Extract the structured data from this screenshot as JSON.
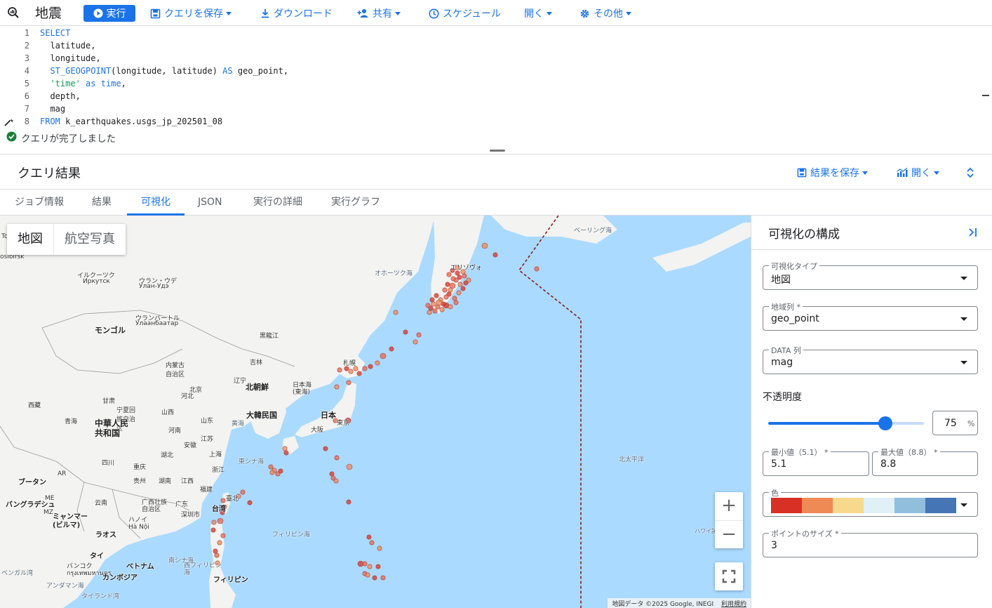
{
  "toolbar": {
    "title": "地震",
    "run": "実行",
    "save_query": "クエリを保存",
    "download": "ダウンロード",
    "share": "共有",
    "schedule": "スケジュール",
    "open": "開く",
    "more": "その他"
  },
  "editor": {
    "lines": [
      {
        "n": "1",
        "text": "SELECT"
      },
      {
        "n": "2",
        "text": "  latitude,"
      },
      {
        "n": "3",
        "text": "  longitude,"
      },
      {
        "n": "4",
        "text": "  ST_GEOGPOINT(longitude, latitude) AS geo_point,"
      },
      {
        "n": "5",
        "text": "  'time' as time,"
      },
      {
        "n": "6",
        "text": "  depth,"
      },
      {
        "n": "7",
        "text": "  mag"
      },
      {
        "n": "8",
        "text": "FROM k_earthquakes.usgs_jp_202501_08"
      }
    ]
  },
  "status": {
    "text": "クエリが完了しました"
  },
  "results": {
    "title": "クエリ結果",
    "save_results": "結果を保存",
    "open": "開く",
    "tabs": [
      "ジョブ情報",
      "結果",
      "可視化",
      "JSON",
      "実行の詳細",
      "実行グラフ"
    ],
    "active_tab": 2
  },
  "map": {
    "type_buttons": {
      "map": "地図",
      "satellite": "航空写真"
    },
    "zoom_in": "+",
    "zoom_out": "−",
    "attribution": "地図データ ©2025 Google, INEGI",
    "terms": "利用規約",
    "labels": {
      "bering": "ベーリング海",
      "okhotsk": "オホーツク海",
      "elizovo": "エリゾヴォ",
      "irkutsk_ja": "イルクーツク",
      "irkutsk_ru": "Иркутск",
      "ulanude_ja": "ウラン・ウデ",
      "ulanude_ru": "Улан-Удэ",
      "ulaanbaatar_ja": "ウランバートル",
      "ulaanbaatar_mn": "Улаанбаатар",
      "mongol": "モンゴル",
      "heilongjiang": "黒龍江",
      "jilin": "吉林",
      "neimenggu": "内蒙古自治区",
      "liaoning": "辽宁",
      "beijing": "北京",
      "hebei": "河北",
      "shanxi": "山西",
      "shandong": "山东",
      "ningxia": "宁夏回族自治区",
      "gansu": "甘肃",
      "qinghai": "青海",
      "north_korea": "北朝鮮",
      "south_korea": "大韓民国",
      "japan_sea": "日本海\n(東海)",
      "japan": "日本",
      "sapporo": "札幌",
      "tokyo": "東京",
      "osaka": "大阪",
      "yellow_sea": "黄海",
      "china": "中華人民\n共和国",
      "henan": "河南",
      "jiangsu": "江苏",
      "shanghai": "上海",
      "anhui": "安徽",
      "zhejiang": "浙江",
      "hubei": "湖北",
      "sichuan": "四川",
      "chongqing": "重庆",
      "hunan": "湖南",
      "jiangxi": "江西",
      "fujian": "福建",
      "guizhou": "贵州",
      "yunnan": "云南",
      "guangxi": "广西壮族\n自治区",
      "guangdong": "广东",
      "shenzhen": "深圳市",
      "taipei": "臺北",
      "taiwan": "台湾",
      "east_china_sea": "東シナ海",
      "philippine_sea": "フィリピン海",
      "south_china_sea": "南シナ海",
      "west_philippine_sea": "西フィリピン\n海",
      "philippines": "フィリピン",
      "bhutan": "ブータン",
      "bangladesh": "バングラデシュ",
      "myanmar": "ミャンマー\n(ビルマ)",
      "hanoi": "ハノイ\nHà Nội",
      "laos": "ラオス",
      "thailand": "タイ",
      "bangkok": "バンコク\nกรุงเทพมหานคร",
      "vietnam": "ベトナム",
      "cambodia": "カンボジア",
      "andaman": "アンダマン海",
      "thai_gulf": "タイランド湾",
      "bengal": "ベンガル湾",
      "pacific": "北太平洋",
      "hawaii": "ハワイ諸島",
      "xizang": "西藏",
      "ar": "AR",
      "me": "ME",
      "mz": "MZ",
      "to": "To",
      "novosibirsk": "osibirsk"
    }
  },
  "panel": {
    "title": "可視化の構成",
    "viz_type": {
      "label": "可視化タイプ",
      "value": "地図"
    },
    "geo_col": {
      "label": "地域列 *",
      "value": "geo_point"
    },
    "data_col": {
      "label": "DATA 列",
      "value": "mag"
    },
    "opacity": {
      "label": "不透明度",
      "value": "75",
      "unit": "%",
      "level": 0.75
    },
    "min": {
      "label": "最小値（5.1） *",
      "value": "5.1"
    },
    "max": {
      "label": "最大値（8.8） *",
      "value": "8.8"
    },
    "color": {
      "label": "色",
      "palette": [
        "#d93025",
        "#ef8a55",
        "#f6d98c",
        "#dff0f7",
        "#92bede",
        "#4575b4"
      ]
    },
    "point_size": {
      "label": "ポイントのサイズ *",
      "value": "3"
    }
  }
}
